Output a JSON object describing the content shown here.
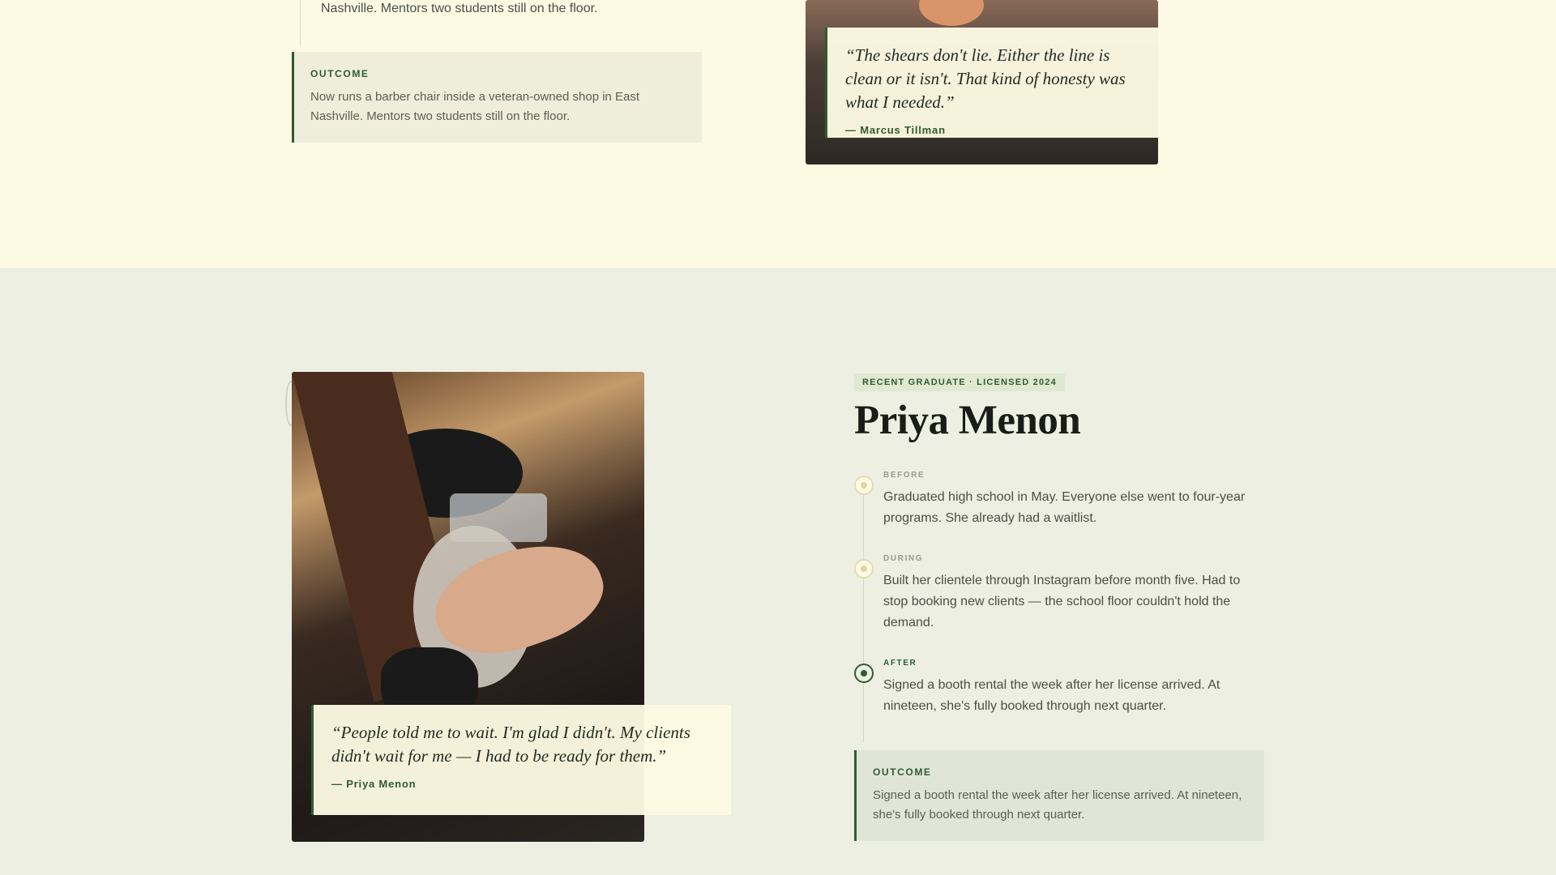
{
  "previous_story": {
    "trailing_text": "Nashville. Mentors two students still on the floor.",
    "outcome": {
      "label": "OUTCOME",
      "text": "Now runs a barber chair inside a veteran-owned shop in East Nashville. Mentors two students still on the floor."
    },
    "quote": {
      "text": "“The shears don't lie. Either the line is clean or it isn't. That kind of honesty was what I needed.”",
      "author": "— Marcus Tillman"
    }
  },
  "story": {
    "badge": "RECENT GRADUATE · LICENSED 2024",
    "name": "Priya Menon",
    "timeline": [
      {
        "label": "BEFORE",
        "text": "Graduated high school in May. Everyone else went to four-year programs. She already had a waitlist."
      },
      {
        "label": "DURING",
        "text": "Built her clientele through Instagram before month five. Had to stop booking new clients — the school floor couldn't hold the demand."
      },
      {
        "label": "AFTER",
        "text": "Signed a booth rental the week after her license arrived. At nineteen, she's fully booked through next quarter."
      }
    ],
    "outcome": {
      "label": "OUTCOME",
      "text": "Signed a booth rental the week after her license arrived. At nineteen, she's fully booked through next quarter."
    },
    "quote": {
      "text": "“People told me to wait. I'm glad I didn't. My clients didn't wait for me — I had to be ready for them.”",
      "author": "— Priya Menon"
    }
  },
  "colors": {
    "accent": "#2e5b34",
    "band_top": "#fdfae3",
    "band_bottom": "#edefe3"
  }
}
